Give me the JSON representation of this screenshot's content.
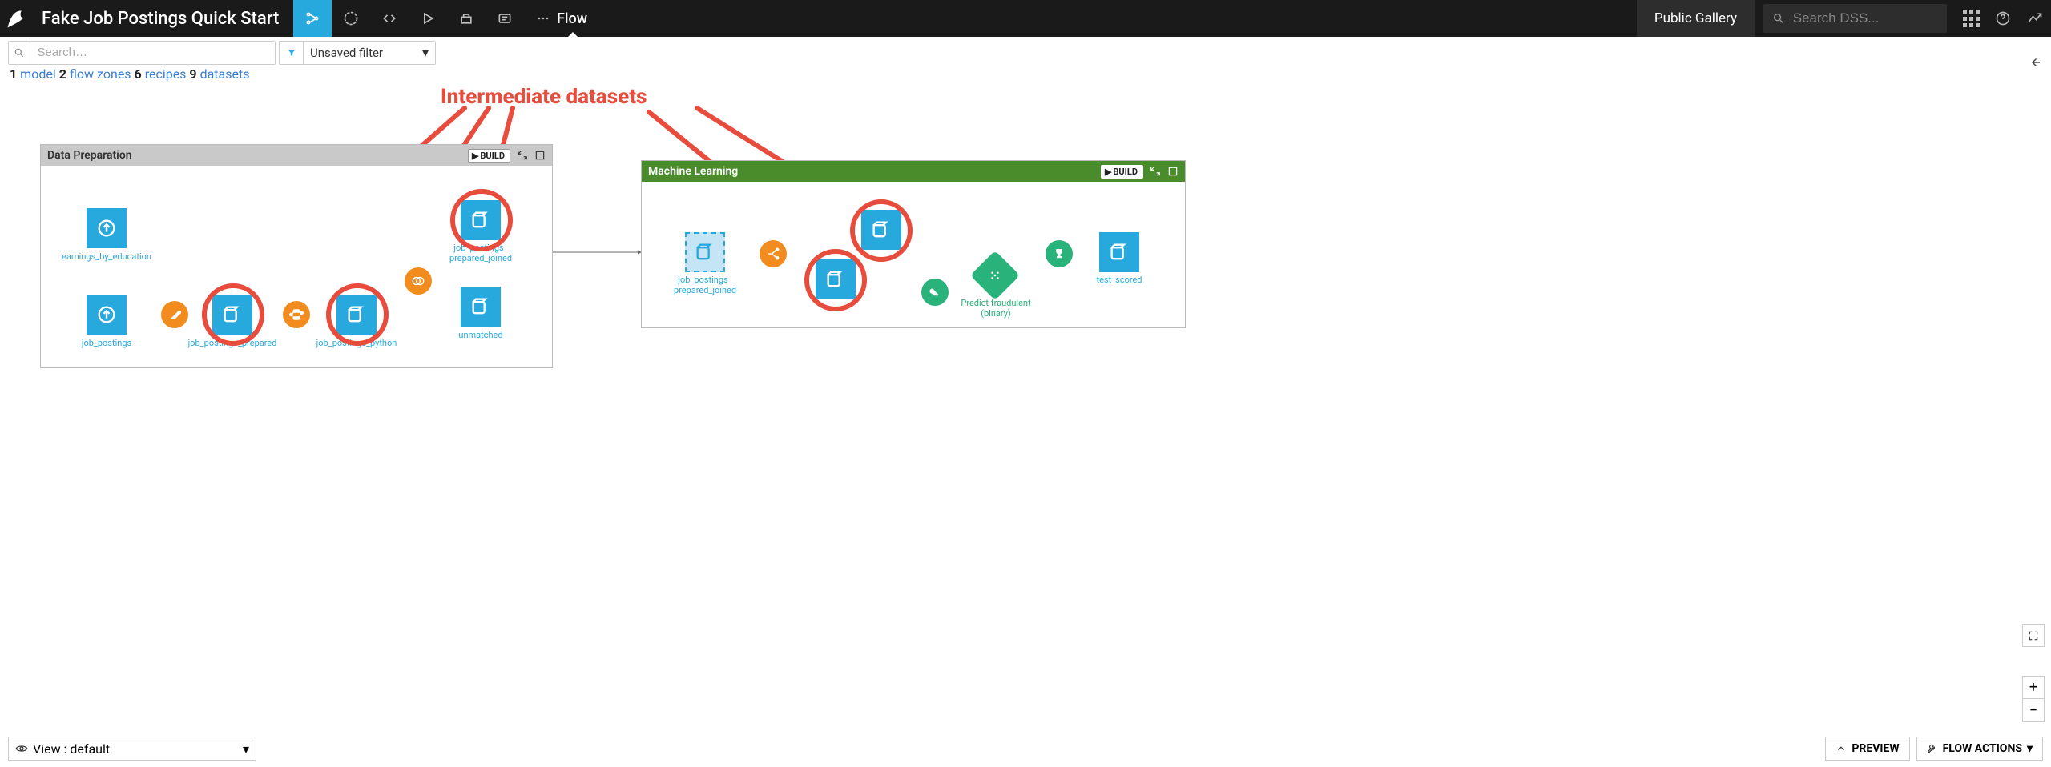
{
  "header": {
    "project_title": "Fake Job Postings Quick Start",
    "flow_label": "Flow",
    "public_gallery": "Public Gallery",
    "search_placeholder": "Search DSS..."
  },
  "subbar": {
    "search_placeholder": "Search…",
    "filter_label": "Unsaved filter"
  },
  "summary": {
    "models_count": "1",
    "models_label": "model",
    "zones_count": "2",
    "zones_label": "flow zones",
    "recipes_count": "6",
    "recipes_label": "recipes",
    "datasets_count": "9",
    "datasets_label": "datasets"
  },
  "zones": {
    "data_prep": {
      "title": "Data Preparation",
      "build_label": "BUILD",
      "nodes": {
        "earnings_by_education": "earnings_by_education",
        "job_postings": "job_postings",
        "job_postings_prepared": "job_postings_prepared",
        "job_postings_python": "job_postings_python",
        "prepared_joined": "job_postings_\nprepared_joined",
        "unmatched": "unmatched"
      }
    },
    "ml": {
      "title": "Machine Learning",
      "build_label": "BUILD",
      "nodes": {
        "prepared_joined_ref": "job_postings_\nprepared_joined",
        "test_scored": "test_scored",
        "predict_model": "Predict fraudulent\n(binary)"
      }
    }
  },
  "annotation": {
    "title": "Intermediate datasets"
  },
  "bottom": {
    "view_label": "View : default",
    "preview_label": "PREVIEW",
    "flow_actions_label": "FLOW ACTIONS"
  }
}
